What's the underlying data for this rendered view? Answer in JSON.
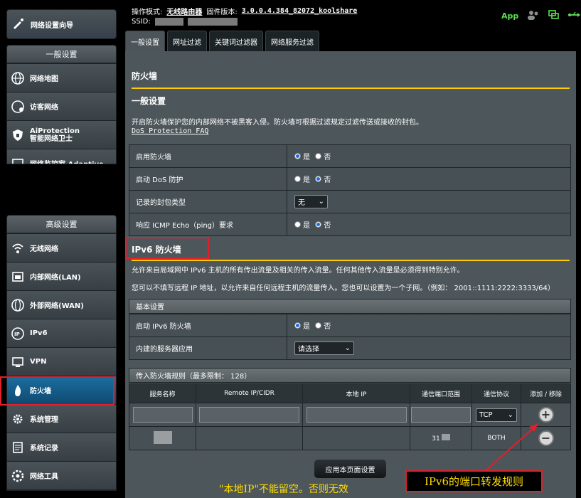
{
  "sidebar": {
    "wizard": "网络设置向导",
    "general_header": "一般设置",
    "general_items": [
      "网络地图",
      "访客网络",
      "AiProtection",
      "智能网络卫士",
      "网络监控家 Adaptive"
    ],
    "advanced_header": "高级设置",
    "advanced_items": [
      "无线网络",
      "内部网络(LAN)",
      "外部网络(WAN)",
      "IPv6",
      "VPN",
      "防火墙",
      "系统管理",
      "系统记录",
      "网络工具"
    ]
  },
  "header": {
    "mode_label": "操作模式:",
    "mode_value": "无线路由器",
    "fw_label": "固件版本:",
    "fw_value": "3.0.0.4.384_82072_koolshare",
    "ssid_label": "SSID:",
    "app": "App"
  },
  "tabs": [
    "一般设置",
    "网址过滤",
    "关键词过滤器",
    "网络服务过滤"
  ],
  "main": {
    "title": "防火墙",
    "general_title": "一般设置",
    "general_desc": "开启防火墙保护您的内部网络不被黑客入侵。防火墙可根据过滤规定过滤传送或接收的封包。",
    "dos_link": "DoS Protection FAQ",
    "settings": [
      {
        "label": "启用防火墙",
        "yes": "是",
        "no": "否",
        "selected": "yes"
      },
      {
        "label": "启动 DoS 防护",
        "yes": "是",
        "no": "否",
        "selected": "no"
      },
      {
        "label": "记录的封包类型",
        "select": "无"
      },
      {
        "label": "响应 ICMP Echo（ping）要求",
        "yes": "是",
        "no": "否",
        "selected": "no"
      }
    ],
    "ipv6_title": "IPv6 防火墙",
    "ipv6_desc1": "允许来自局域网中 IPv6 主机的所有传出流量及相关的传入流量。任何其他传入流量是必须得到特别允许。",
    "ipv6_desc2": "您可以不填写远程 IP 地址，以允许来自任何远程主机的流量传入。您也可以设置为一个子网。（例如： 2001::1111:2222:3333/64）",
    "basic_head": "基本设置",
    "ipv6_enable_label": "启动 IPv6 防火墙",
    "ipv6_enable_yes": "是",
    "ipv6_enable_no": "否",
    "builtin_label": "内建的服务器应用",
    "builtin_select": "请选择",
    "rules_head": "传入防火墙规则（最多限制： 128）",
    "columns": [
      "服务名称",
      "Remote IP/CIDR",
      "本地 IP",
      "通信端口范围",
      "通信协议",
      "添加 / 移除"
    ],
    "new_row_protocol": "TCP",
    "existing_row": {
      "port": "31",
      "protocol": "BOTH"
    },
    "apply": "应用本页面设置"
  },
  "annotations": {
    "note": "\"本地IP\"不能留空。否则无效",
    "label": "IPv6的端口转发规则"
  }
}
